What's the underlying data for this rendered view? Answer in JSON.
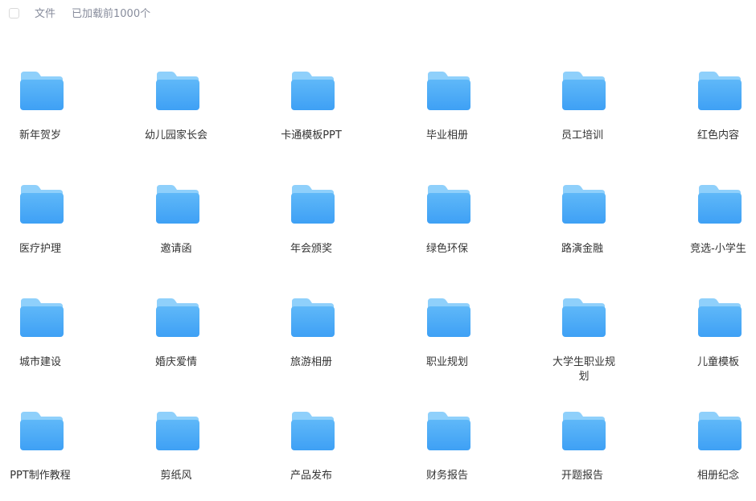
{
  "header": {
    "column_label": "文件",
    "loaded_count": "已加载前1000个"
  },
  "folders": [
    {
      "name": "新年贺岁"
    },
    {
      "name": "幼儿园家长会"
    },
    {
      "name": "卡通模板PPT"
    },
    {
      "name": "毕业相册"
    },
    {
      "name": "员工培训"
    },
    {
      "name": "红色内容"
    },
    {
      "name": "医疗护理"
    },
    {
      "name": "邀请函"
    },
    {
      "name": "年会颁奖"
    },
    {
      "name": "绿色环保"
    },
    {
      "name": "路演金融"
    },
    {
      "name": "竞选-小学生"
    },
    {
      "name": "城市建设"
    },
    {
      "name": "婚庆爱情"
    },
    {
      "name": "旅游相册"
    },
    {
      "name": "职业规划"
    },
    {
      "name": "大学生职业规划"
    },
    {
      "name": "儿童模板"
    },
    {
      "name": "PPT制作教程"
    },
    {
      "name": "剪纸风"
    },
    {
      "name": "产品发布"
    },
    {
      "name": "财务报告"
    },
    {
      "name": "开题报告"
    },
    {
      "name": "相册纪念"
    }
  ],
  "icon": "folder-icon",
  "colors": {
    "folder_back": "#8fd0fb",
    "folder_front_top": "#5fb8f8",
    "folder_front_bottom": "#3ea0f5",
    "header_text": "#878c9c",
    "label_text": "#333333"
  }
}
